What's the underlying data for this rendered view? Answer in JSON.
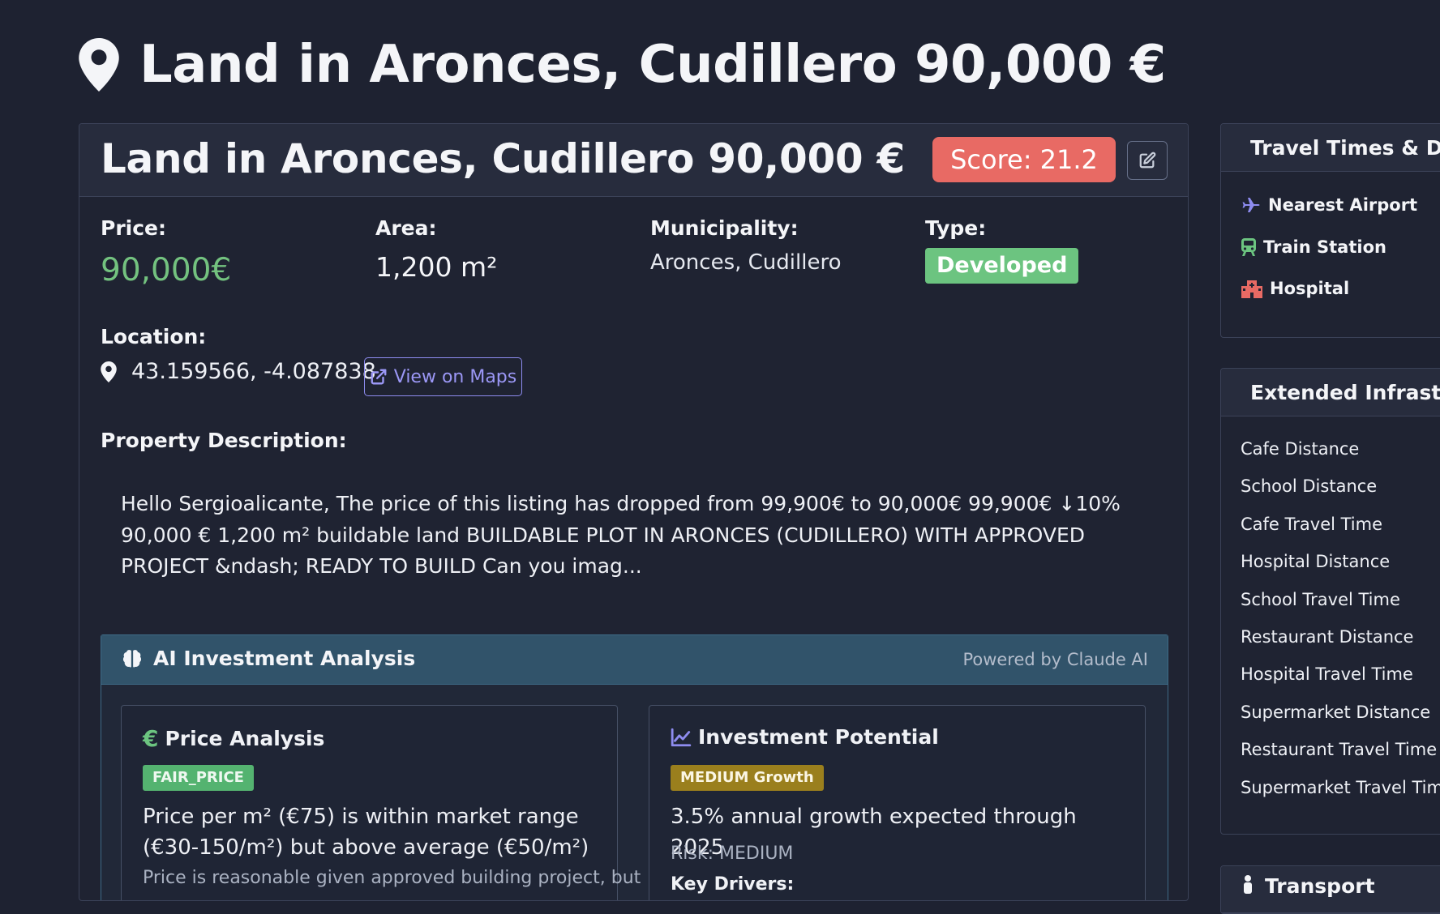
{
  "page": {
    "title": "Land in Aronces, Cudillero 90,000 €"
  },
  "card": {
    "title": "Land in Aronces, Cudillero 90,000 €",
    "score": "Score: 21.2",
    "price_label": "Price:",
    "price_value": "90,000€",
    "area_label": "Area:",
    "area_value": "1,200 m²",
    "municipality_label": "Municipality:",
    "municipality_value": "Aronces, Cudillero",
    "type_label": "Type:",
    "type_value": "Developed",
    "location_label": "Location:",
    "coordinates": "43.159566, -4.087838",
    "maps_button": "View on Maps",
    "description_label": "Property Description:",
    "description": "Hello Sergioalicante, The price of this listing has dropped from 99,900€ to 90,000€ 99,900€ ↓10% 90,000 € 1,200 m² buildable land BUILDABLE PLOT IN ARONCES (CUDILLERO) WITH APPROVED PROJECT &ndash; READY TO BUILD Can you imag..."
  },
  "ai": {
    "title": "AI Investment Analysis",
    "powered_by": "Powered by Claude AI",
    "price_analysis": {
      "title": "Price Analysis",
      "tag": "FAIR_PRICE",
      "text": "Price per m² (€75) is within market range (€30-150/m²) but above average (€50/m²)",
      "more": "Price is reasonable given approved building project, but"
    },
    "investment": {
      "title": "Investment Potential",
      "tag": "MEDIUM Growth",
      "text": "3.5% annual growth expected through 2025",
      "risk": "Risk: MEDIUM",
      "drivers": "Key Drivers:"
    }
  },
  "sidebar": {
    "travel_title": "Travel Times & Distances",
    "travel_items": [
      "Nearest Airport",
      "Train Station",
      "Hospital"
    ],
    "infra_title": "Extended Infrastructure",
    "infra_items": [
      "Cafe Distance",
      "School Distance",
      "Cafe Travel Time",
      "Hospital Distance",
      "School Travel Time",
      "Restaurant Distance",
      "Hospital Travel Time",
      "Supermarket Distance",
      "Restaurant Travel Time",
      "Supermarket Travel Time"
    ],
    "transport_title": "Transport"
  },
  "colors": {
    "background": "#1e2231",
    "score": "#e86a64",
    "price": "#73c27f",
    "type_badge": "#6cc480",
    "accent": "#8e8cf0",
    "fair_price_tag": "#54b370",
    "growth_tag": "#9a7f1d",
    "hospital_icon": "#e86a64",
    "train_icon": "#6cc480"
  }
}
